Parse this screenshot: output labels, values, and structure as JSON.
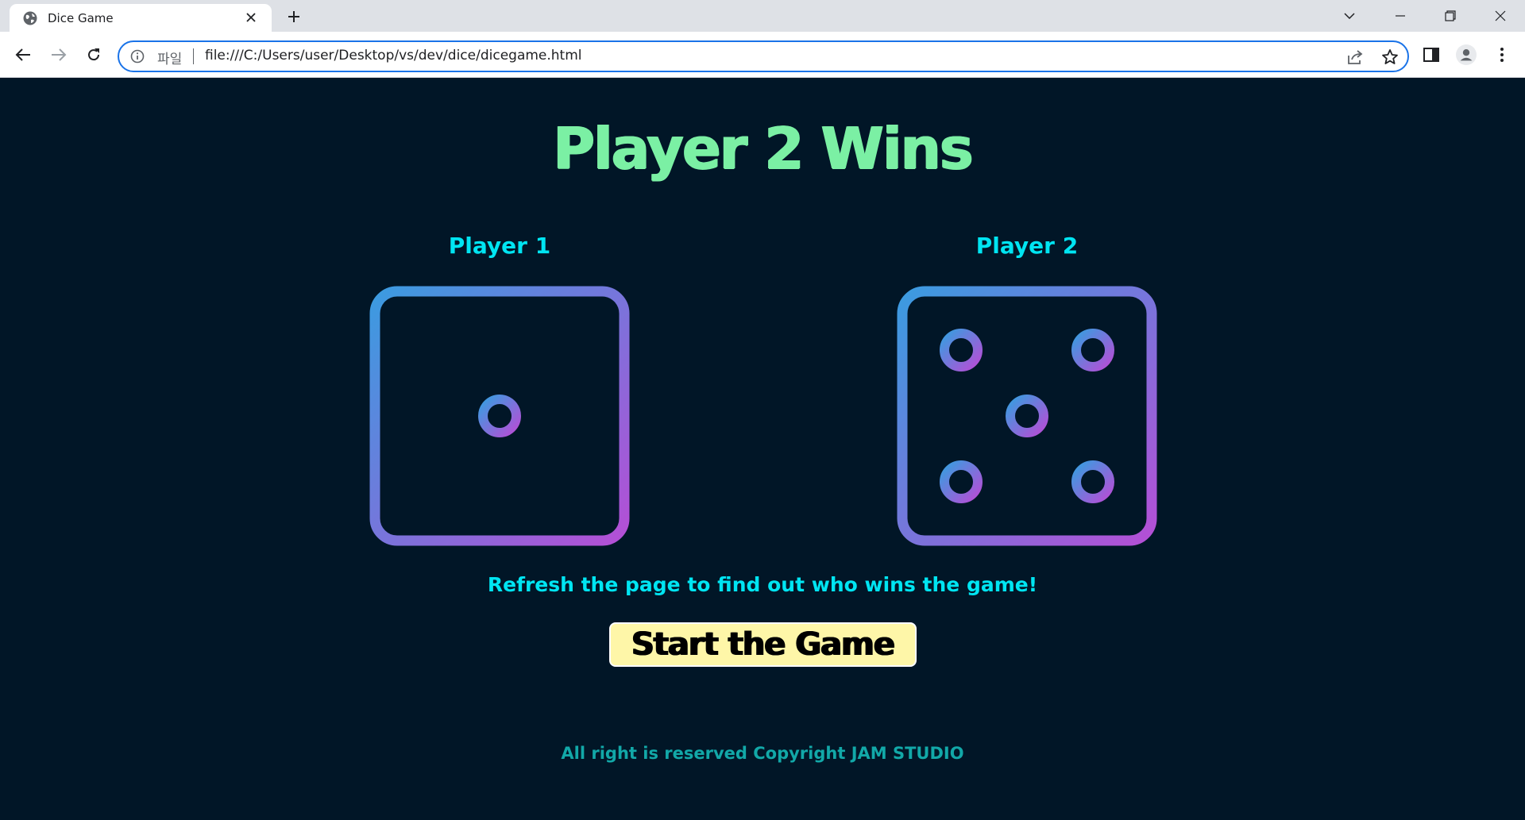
{
  "browser": {
    "tab_title": "Dice Game",
    "url_scheme_label": "파일",
    "url": "file:///C:/Users/user/Desktop/vs/dev/dice/dicegame.html",
    "icons": [
      "globe-icon",
      "close-icon",
      "plus-icon",
      "chevron-down-icon",
      "minimize-icon",
      "restore-icon",
      "close-window-icon",
      "back-icon",
      "forward-icon",
      "reload-icon",
      "info-icon",
      "share-icon",
      "star-icon",
      "side-panel-icon",
      "profile-icon",
      "more-vert-icon"
    ]
  },
  "game": {
    "headline": "Player 2 Wins",
    "players": [
      {
        "label": "Player 1",
        "die_value": 1
      },
      {
        "label": "Player 2",
        "die_value": 5
      }
    ],
    "hint": "Refresh the page to find out who wins the game!",
    "start_button": "Start the Game",
    "footer": "All right is reserved Copyright JAM STUDIO",
    "colors": {
      "background": "#011627",
      "headline": "#7bf0a4",
      "labels": "#00e5f2",
      "die_gradient_start": "#3b9be0",
      "die_gradient_end": "#b44fd6",
      "button_bg": "#fef6a8",
      "footer": "#12a8a8"
    }
  }
}
